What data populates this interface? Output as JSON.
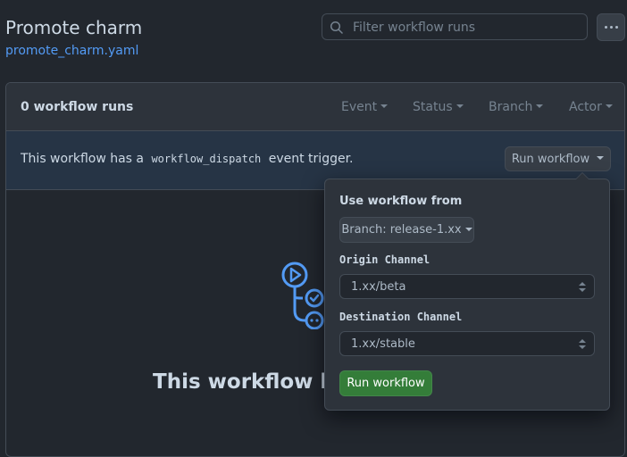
{
  "header": {
    "title": "Promote charm",
    "file_link": "promote_charm.yaml",
    "search_placeholder": "Filter workflow runs"
  },
  "runs": {
    "count_label": "0 workflow runs",
    "filters": [
      "Event",
      "Status",
      "Branch",
      "Actor"
    ]
  },
  "dispatch": {
    "text_before": "This workflow has a",
    "code": "workflow_dispatch",
    "text_after": "event trigger.",
    "run_button": "Run workflow"
  },
  "empty_state": {
    "title": "This workflow has"
  },
  "popover": {
    "use_from_label": "Use workflow from",
    "branch_button": "Branch: release-1.xx",
    "origin_label": "Origin Channel",
    "origin_value": "1.xx/beta",
    "destination_label": "Destination Channel",
    "destination_value": "1.xx/stable",
    "submit_label": "Run workflow"
  },
  "colors": {
    "accent": "#539bf5",
    "success": "#347d39",
    "background": "#22272e"
  },
  "icons": {
    "search": "search-icon",
    "kebab": "kebab-horizontal-icon",
    "empty": "workflow-icon"
  }
}
